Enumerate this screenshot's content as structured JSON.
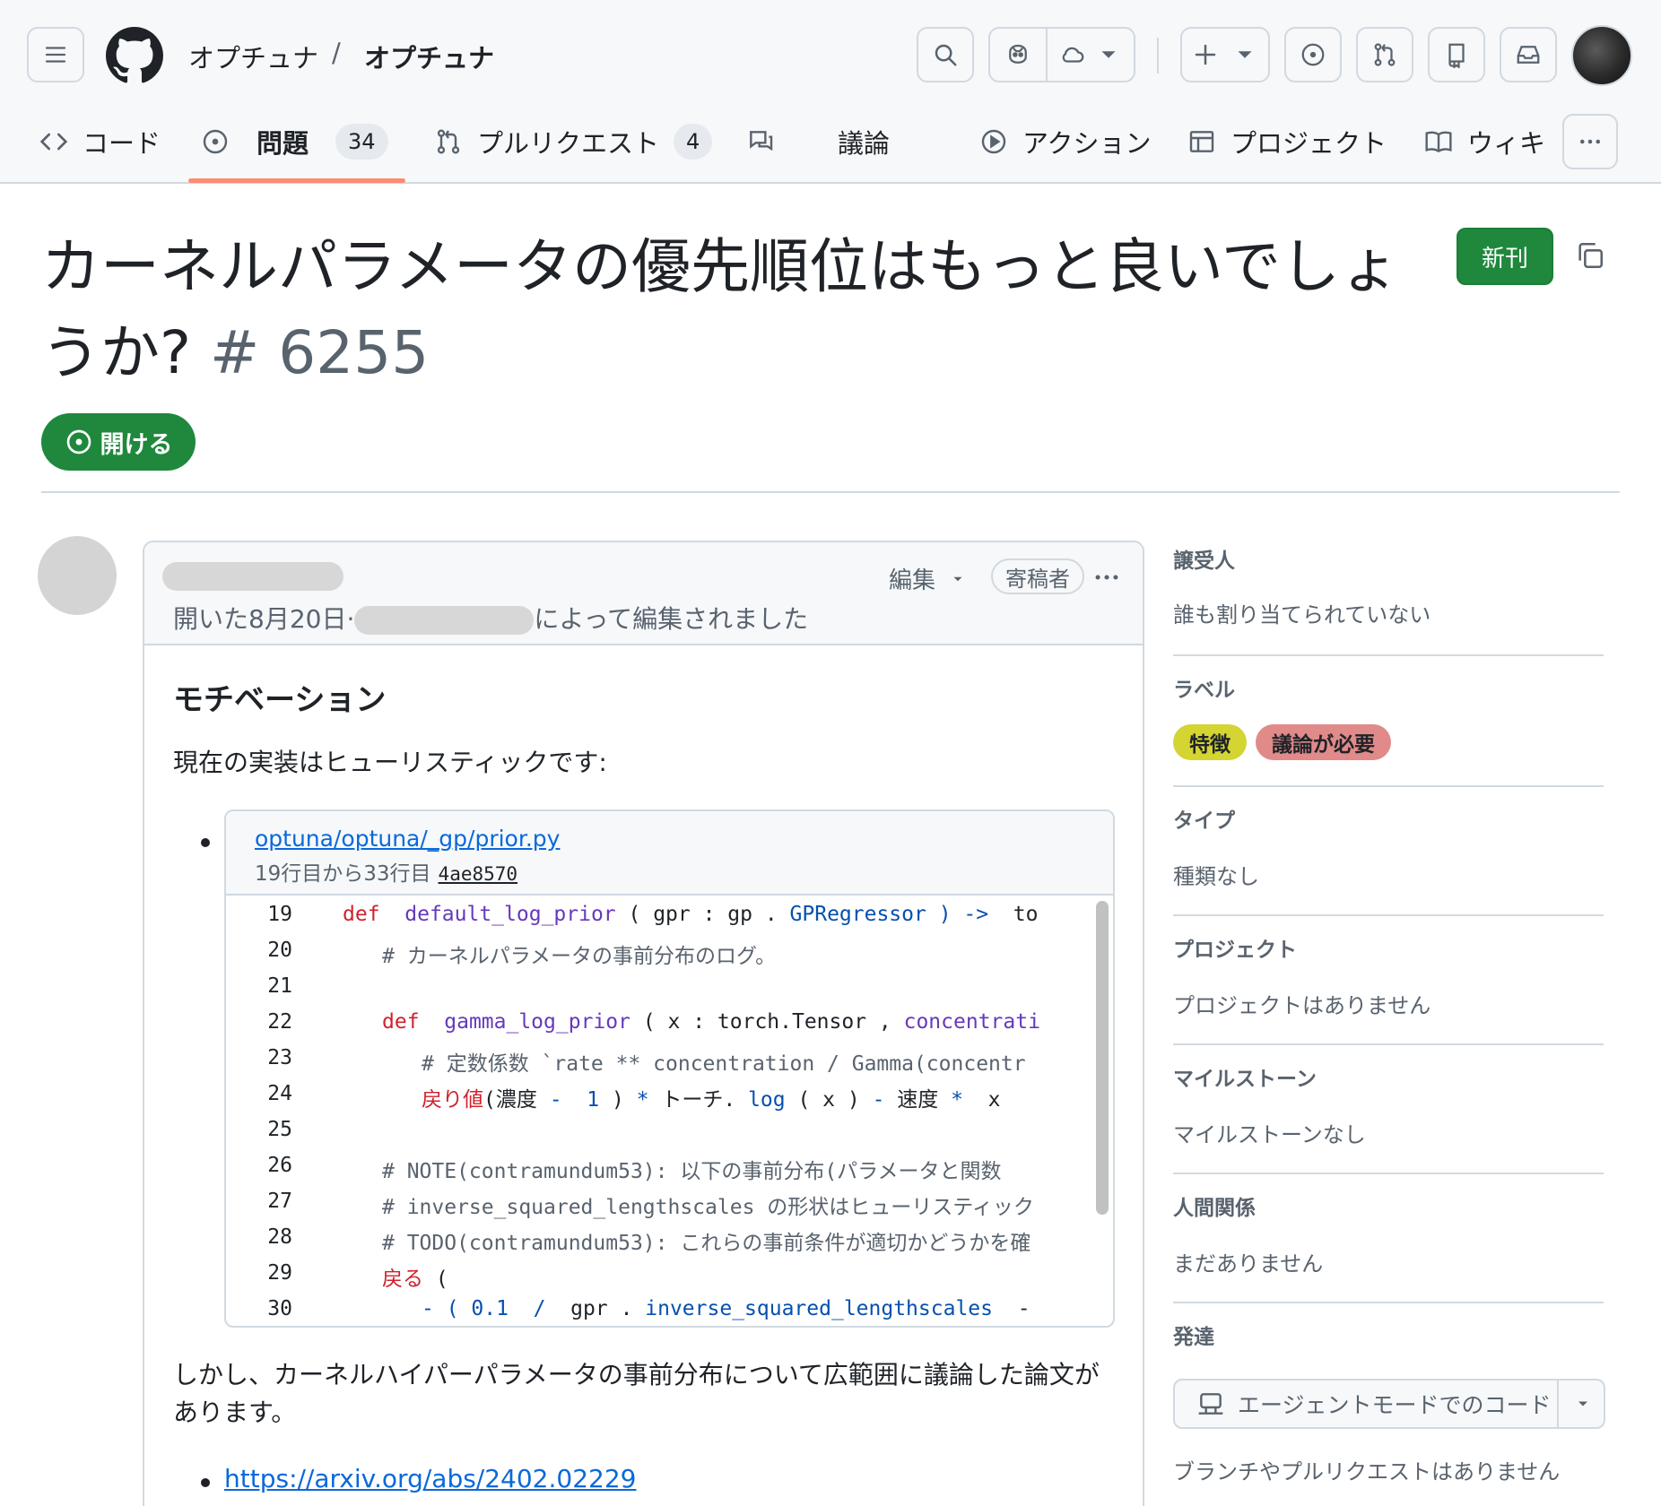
{
  "header": {
    "owner": "オプチュナ",
    "separator": "/",
    "repo": "オプチュナ"
  },
  "tabs": [
    {
      "label": "コード"
    },
    {
      "label": "問題",
      "count": "34"
    },
    {
      "label": "プルリクエスト",
      "count": "4"
    },
    {
      "label": "議論"
    },
    {
      "label": "アクション"
    },
    {
      "label": "プロジェクト"
    },
    {
      "label": "ウィキ"
    }
  ],
  "issue": {
    "title": "カーネルパラメータの優先順位はもっと良いでしょうか?",
    "number": "# 6255",
    "new_button": "新刊",
    "state": "開ける"
  },
  "comment": {
    "meta_prefix": "開いた8月20日·",
    "meta_suffix": "によって編集されました",
    "edit_label": "編集",
    "role_badge": "寄稿者",
    "heading": "モチベーション",
    "paragraph1": "現在の実装はヒューリスティックです:",
    "snippet": {
      "path": "optuna/optuna/_gp/prior.py",
      "range": "19行目から33行目",
      "sha": "4ae8570"
    },
    "line_numbers": [
      "19",
      "20",
      "21",
      "22",
      "23",
      "24",
      "25",
      "26",
      "27",
      "28",
      "29",
      "30"
    ],
    "code_text": {
      "l19_def": "def",
      "l19_name": "default_log_prior",
      "l19_p1": " ( gpr : gp . ",
      "l19_cls": "GPRegressor",
      "l19_arrow": " ) ->",
      "l19_tail": "  to",
      "l20": "# カーネルパラメータの事前分布のログ。",
      "l22_def": "def",
      "l22_name": "gamma_log_prior",
      "l22_p": " ( x : torch.Tensor , ",
      "l22_tail": "concentrati",
      "l23": "# 定数係数 `rate ** concentration / Gamma(concentr",
      "l24_kw": "戻り値",
      "l24_a": "(濃度 ",
      "l24_op": "-",
      "l24_num": "1",
      "l24_b": " ) ",
      "l24_star": "*",
      "l24_c": " トーチ. ",
      "l24_log": "log",
      "l24_d": " ( x ) ",
      "l24_minus": "-",
      "l24_e": " 速度 ",
      "l24_star2": "*",
      "l24_f": "  x",
      "l26": "# NOTE(contramundum53): 以下の事前分布(パラメータと関数",
      "l27": "# inverse_squared_lengthscales の形状はヒューリスティック",
      "l28": "# TODO(contramundum53): これらの事前条件が適切かどうかを確",
      "l29_kw": "戻る",
      "l29_rest": " (",
      "l30_minus": "- ( ",
      "l30_num": "0.1",
      "l30_slash": "  /",
      "l30_mid": "  gpr . ",
      "l30_attr": "inverse_squared_lengthscales",
      "l30_tail": "  -"
    },
    "paragraph2": "しかし、カーネルハイパーパラメータの事前分布について広範囲に議論した論文があります。",
    "link": "https://arxiv.org/abs/2402.02229"
  },
  "sidebar": {
    "assignees_h": "譲受人",
    "assignees_v": "誰も割り当てられていない",
    "labels_h": "ラベル",
    "labels": [
      {
        "name": "特徴",
        "color": "#d4d433"
      },
      {
        "name": "議論が必要",
        "color": "#e08a8a"
      }
    ],
    "type_h": "タイプ",
    "type_v": "種類なし",
    "projects_h": "プロジェクト",
    "projects_v": "プロジェクトはありません",
    "milestone_h": "マイルストーン",
    "milestone_v": "マイルストーンなし",
    "relationships_h": "人間関係",
    "relationships_v": "まだありません",
    "development_h": "発達",
    "agent_button": "エージェントモードでのコード",
    "development_v": "ブランチやプルリクエストはありません"
  },
  "colors": {
    "accent_green": "#1f883d",
    "tab_underline": "#fd8c73",
    "link_blue": "#0969da"
  }
}
